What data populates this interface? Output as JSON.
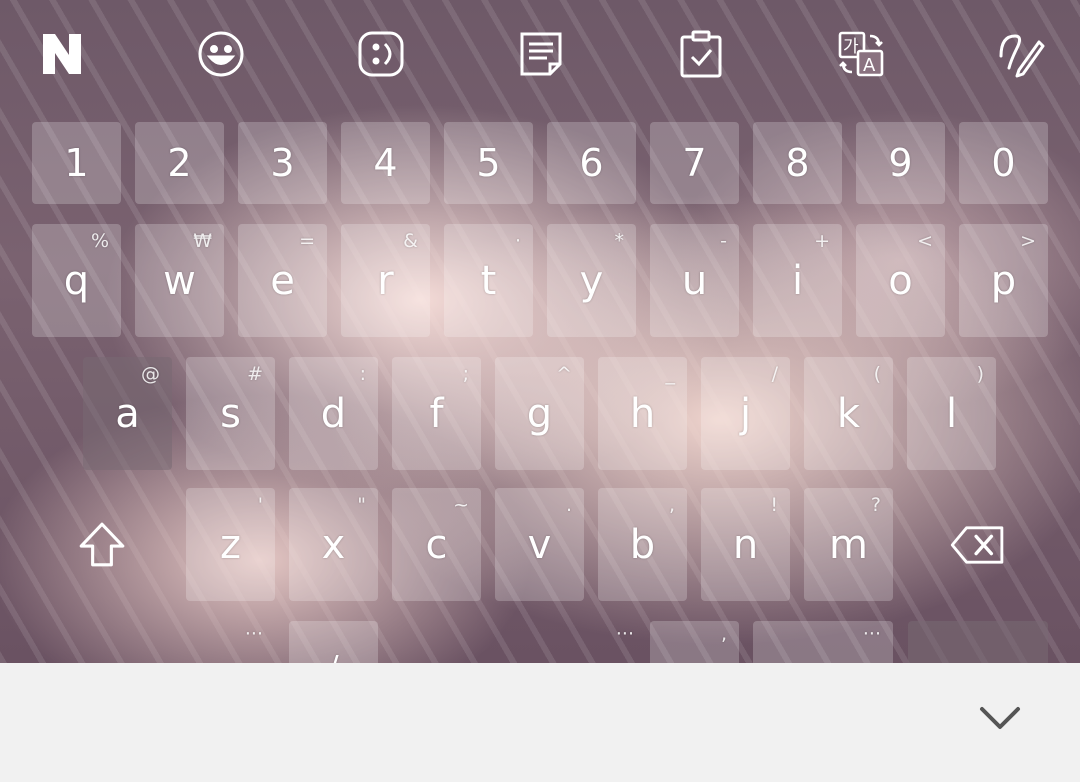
{
  "toolbar": {
    "items": [
      {
        "name": "naver-logo-icon"
      },
      {
        "name": "emoji-icon"
      },
      {
        "name": "emoticon-icon"
      },
      {
        "name": "memo-icon"
      },
      {
        "name": "clipboard-icon"
      },
      {
        "name": "translate-icon"
      },
      {
        "name": "handwriting-icon"
      }
    ],
    "logo_text": "N",
    "translate_ko": "가",
    "translate_en": "A"
  },
  "keyboard": {
    "number_row": [
      "1",
      "2",
      "3",
      "4",
      "5",
      "6",
      "7",
      "8",
      "9",
      "0"
    ],
    "row1": [
      {
        "key": "q",
        "sub": "%"
      },
      {
        "key": "w",
        "sub": "₩"
      },
      {
        "key": "e",
        "sub": "="
      },
      {
        "key": "r",
        "sub": "&"
      },
      {
        "key": "t",
        "sub": "·"
      },
      {
        "key": "y",
        "sub": "*"
      },
      {
        "key": "u",
        "sub": "-"
      },
      {
        "key": "i",
        "sub": "+"
      },
      {
        "key": "o",
        "sub": "<"
      },
      {
        "key": "p",
        "sub": ">"
      }
    ],
    "row2": [
      {
        "key": "a",
        "sub": "@"
      },
      {
        "key": "s",
        "sub": "#"
      },
      {
        "key": "d",
        "sub": ":"
      },
      {
        "key": "f",
        "sub": ";"
      },
      {
        "key": "g",
        "sub": "^"
      },
      {
        "key": "h",
        "sub": "_"
      },
      {
        "key": "j",
        "sub": "/"
      },
      {
        "key": "k",
        "sub": "("
      },
      {
        "key": "l",
        "sub": ")"
      }
    ],
    "row3": [
      {
        "key": "z",
        "sub": "'"
      },
      {
        "key": "x",
        "sub": "\""
      },
      {
        "key": "c",
        "sub": "~"
      },
      {
        "key": "v",
        "sub": "."
      },
      {
        "key": "b",
        "sub": ","
      },
      {
        "key": "n",
        "sub": "!"
      },
      {
        "key": "m",
        "sub": "?"
      }
    ],
    "bottom_row": {
      "key1_sub": "···",
      "key2_main": "/",
      "space_sub": "···",
      "comma_sub": ",",
      "key5_sub": "···"
    }
  },
  "colors": {
    "key_bg": "rgba(255,255,255,0.22)",
    "bar_bg": "#f1f1f1",
    "chevron": "#555555"
  }
}
